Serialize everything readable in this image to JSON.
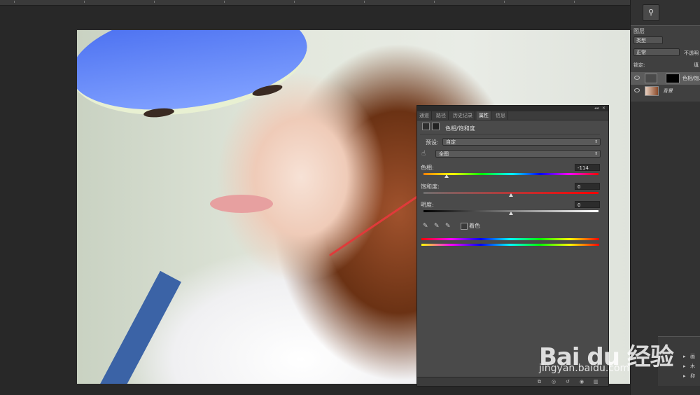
{
  "dock": {
    "icon": "brush-tool-icon"
  },
  "layers_panel": {
    "title": "图层",
    "filter_select": "类型",
    "blend_mode": "正常",
    "opacity_label": "不透明",
    "lock_label": "锁定:",
    "fill_label": "填",
    "layers": [
      {
        "name": "色相/饱…",
        "selected": true
      },
      {
        "name": "背景",
        "selected": false
      }
    ]
  },
  "properties_panel": {
    "tabs": [
      "通道",
      "路径",
      "历史记录",
      "属性",
      "信息"
    ],
    "active_tab": "属性",
    "title": "色相/饱和度",
    "preset_label": "预设:",
    "preset_value": "自定",
    "channel_value": "全图",
    "hue_label": "色相:",
    "hue_value": "-114",
    "saturation_label": "饱和度:",
    "saturation_value": "0",
    "lightness_label": "明度:",
    "lightness_value": "0",
    "colorize_label": "着色",
    "collapse_glyph": "◂◂",
    "close_glyph": "✕"
  },
  "lower_panel": {
    "rows": [
      "画",
      "木",
      "抑"
    ]
  },
  "watermark": {
    "brand": "Bai du 经验",
    "url": "jingyan.baidu.com"
  },
  "colors": {
    "app_bg": "#282828",
    "panel_bg": "#4a4a4a",
    "annotation_arrow": "#e03a3a"
  }
}
